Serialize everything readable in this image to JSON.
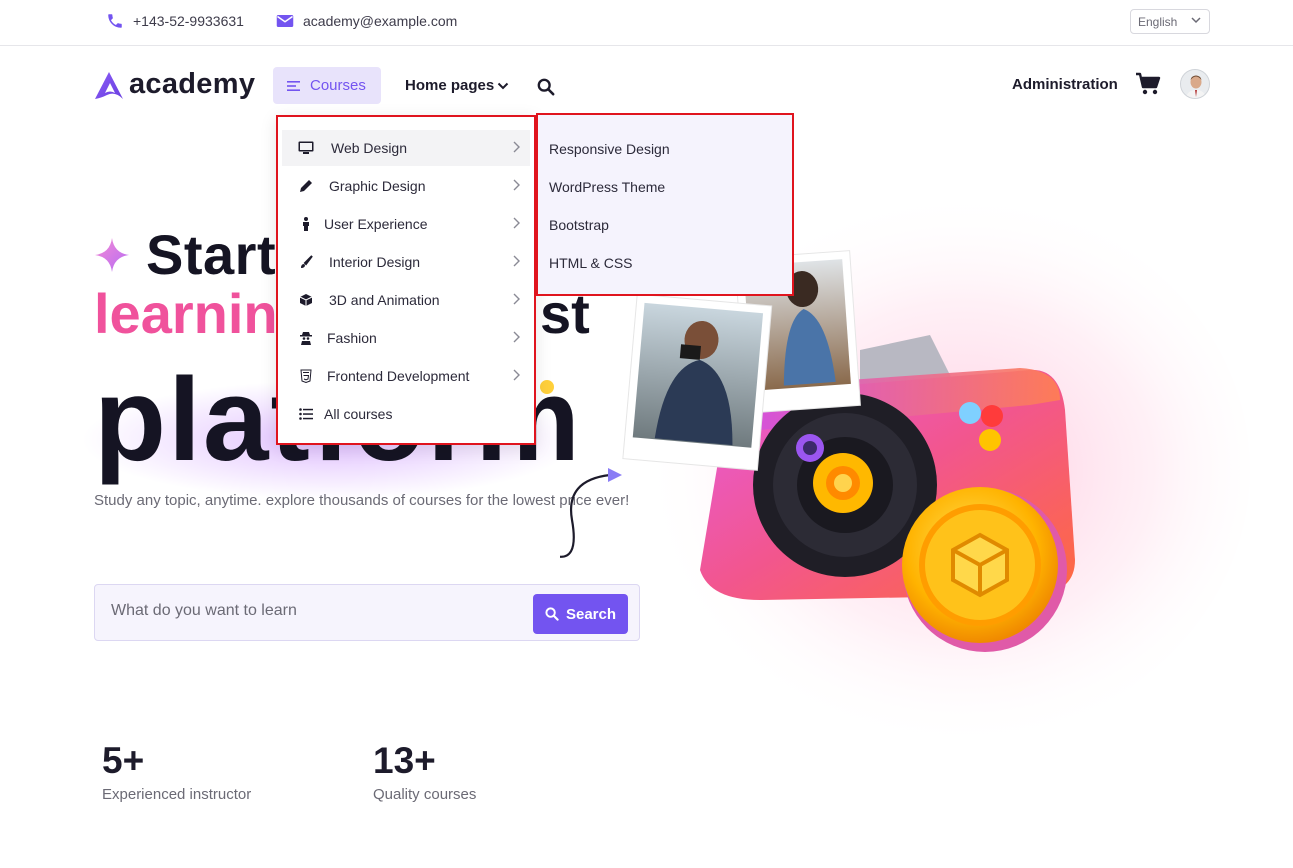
{
  "topbar": {
    "phone": "+143-52-9933631",
    "email": "academy@example.com",
    "language": "English"
  },
  "navbar": {
    "logo_text": "academy",
    "courses_label": "Courses",
    "home_pages_label": "Home pages",
    "admin_label": "Administration"
  },
  "courses_menu": {
    "items": [
      {
        "label": "Web Design",
        "icon": "monitor-icon"
      },
      {
        "label": "Graphic Design",
        "icon": "pen-icon"
      },
      {
        "label": "User Experience",
        "icon": "person-icon"
      },
      {
        "label": "Interior Design",
        "icon": "brush-icon"
      },
      {
        "label": "3D and Animation",
        "icon": "cube-icon"
      },
      {
        "label": "Fashion",
        "icon": "user-secret-icon"
      },
      {
        "label": "Frontend Development",
        "icon": "html5-icon"
      },
      {
        "label": "All courses",
        "icon": "list-icon"
      }
    ],
    "submenu": [
      "Responsive Design",
      "WordPress Theme",
      "Bootstrap",
      "HTML & CSS"
    ]
  },
  "hero": {
    "line1": "Start",
    "line2_pink": "learnin",
    "line2_dark": "st",
    "line3": "platform",
    "subtitle": "Study any topic, anytime. explore thousands of courses for the lowest price ever!",
    "search_placeholder": "What do you want to learn",
    "search_button": "Search"
  },
  "stats": [
    {
      "value": "5+",
      "label": "Experienced instructor"
    },
    {
      "value": "13+",
      "label": "Quality courses"
    }
  ],
  "colors": {
    "primary": "#7354f0",
    "pink": "#f0529c",
    "highlight_border": "#e0141e"
  }
}
